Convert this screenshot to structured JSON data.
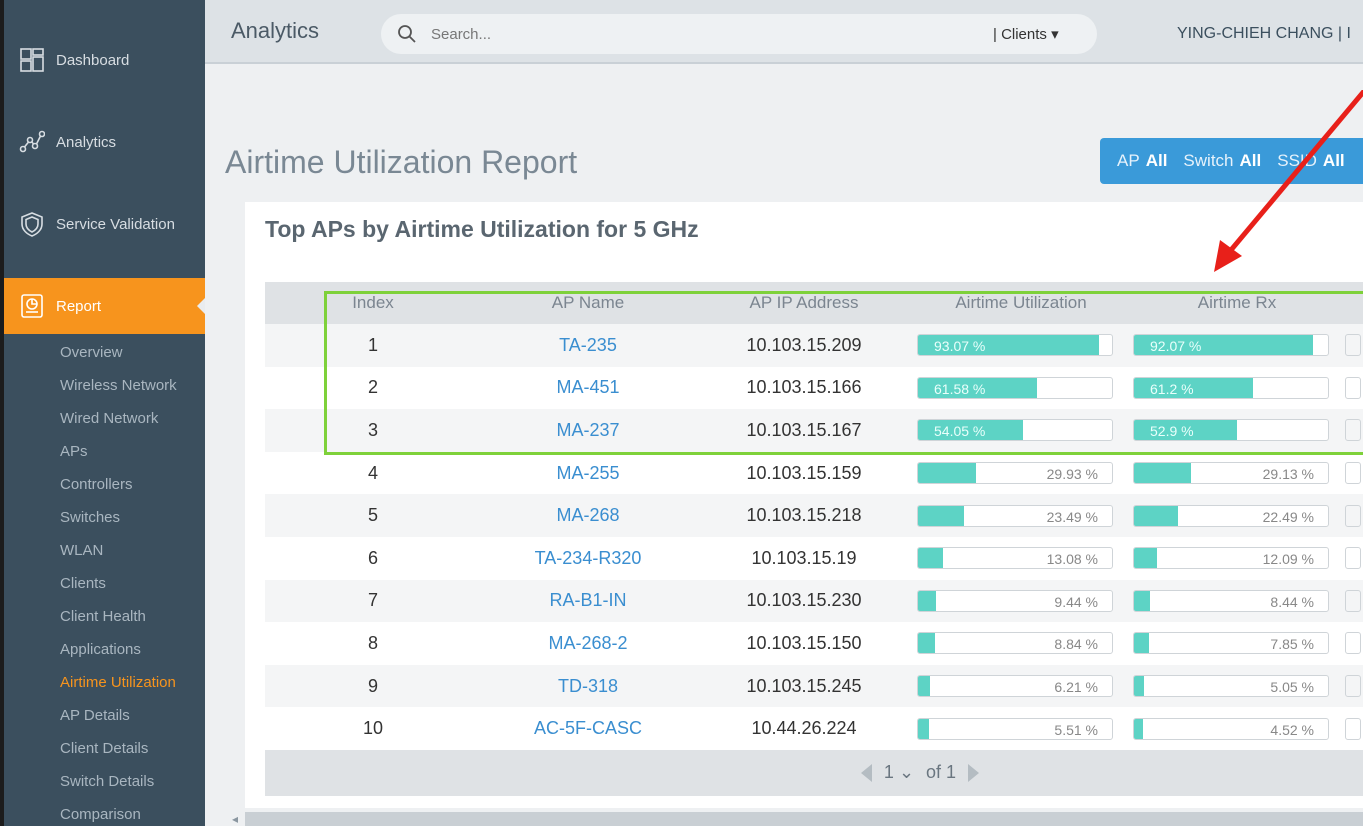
{
  "sidebar": {
    "nav": [
      {
        "label": "Dashboard",
        "icon": "dashboard-icon"
      },
      {
        "label": "Analytics",
        "icon": "analytics-icon"
      },
      {
        "label": "Service Validation",
        "icon": "shield-icon"
      },
      {
        "label": "Report",
        "icon": "report-icon"
      }
    ],
    "report_items": [
      "Overview",
      "Wireless Network",
      "Wired Network",
      "APs",
      "Controllers",
      "Switches",
      "WLAN",
      "Clients",
      "Client Health",
      "Applications",
      "Airtime Utilization",
      "AP Details",
      "Client Details",
      "Switch Details",
      "Comparison"
    ],
    "active_item": "Airtime Utilization"
  },
  "header": {
    "title": "Analytics",
    "search_placeholder": "Search...",
    "scope": "| Clients ▾",
    "user": "YING-CHIEH CHANG | I"
  },
  "page": {
    "title": "Airtime Utilization Report",
    "filter": {
      "ap_label": "AP",
      "ap_value": "All",
      "switch_label": "Switch",
      "switch_value": "All",
      "ssid_label": "SSID",
      "ssid_value": "All"
    }
  },
  "card": {
    "title": "Top APs by Airtime Utilization for 5 GHz",
    "columns": [
      "Index",
      "AP Name",
      "AP IP Address",
      "Airtime Utilization",
      "Airtime Rx"
    ],
    "rows": [
      {
        "index": "1",
        "name": "TA-235",
        "ip": "10.103.15.209",
        "util": "93.07 %",
        "util_pct": 93.07,
        "rx": "92.07 %",
        "rx_pct": 92.07
      },
      {
        "index": "2",
        "name": "MA-451",
        "ip": "10.103.15.166",
        "util": "61.58 %",
        "util_pct": 61.58,
        "rx": "61.2 %",
        "rx_pct": 61.2
      },
      {
        "index": "3",
        "name": "MA-237",
        "ip": "10.103.15.167",
        "util": "54.05 %",
        "util_pct": 54.05,
        "rx": "52.9 %",
        "rx_pct": 52.9
      },
      {
        "index": "4",
        "name": "MA-255",
        "ip": "10.103.15.159",
        "util": "29.93 %",
        "util_pct": 29.93,
        "rx": "29.13 %",
        "rx_pct": 29.13
      },
      {
        "index": "5",
        "name": "MA-268",
        "ip": "10.103.15.218",
        "util": "23.49 %",
        "util_pct": 23.49,
        "rx": "22.49 %",
        "rx_pct": 22.49
      },
      {
        "index": "6",
        "name": "TA-234-R320",
        "ip": "10.103.15.19",
        "util": "13.08 %",
        "util_pct": 13.08,
        "rx": "12.09 %",
        "rx_pct": 12.09
      },
      {
        "index": "7",
        "name": "RA-B1-IN",
        "ip": "10.103.15.230",
        "util": "9.44 %",
        "util_pct": 9.44,
        "rx": "8.44 %",
        "rx_pct": 8.44
      },
      {
        "index": "8",
        "name": "MA-268-2",
        "ip": "10.103.15.150",
        "util": "8.84 %",
        "util_pct": 8.84,
        "rx": "7.85 %",
        "rx_pct": 7.85
      },
      {
        "index": "9",
        "name": "TD-318",
        "ip": "10.103.15.245",
        "util": "6.21 %",
        "util_pct": 6.21,
        "rx": "5.05 %",
        "rx_pct": 5.05
      },
      {
        "index": "10",
        "name": "AC-5F-CASC",
        "ip": "10.44.26.224",
        "util": "5.51 %",
        "util_pct": 5.51,
        "rx": "4.52 %",
        "rx_pct": 4.52
      }
    ],
    "pager": {
      "page": "1",
      "of": "of 1"
    }
  },
  "colors": {
    "accent": "#f7941d",
    "bar": "#5dd3c5",
    "filter": "#3a9ad9",
    "highlight": "#7ed13a",
    "arrow": "#e8201a"
  }
}
